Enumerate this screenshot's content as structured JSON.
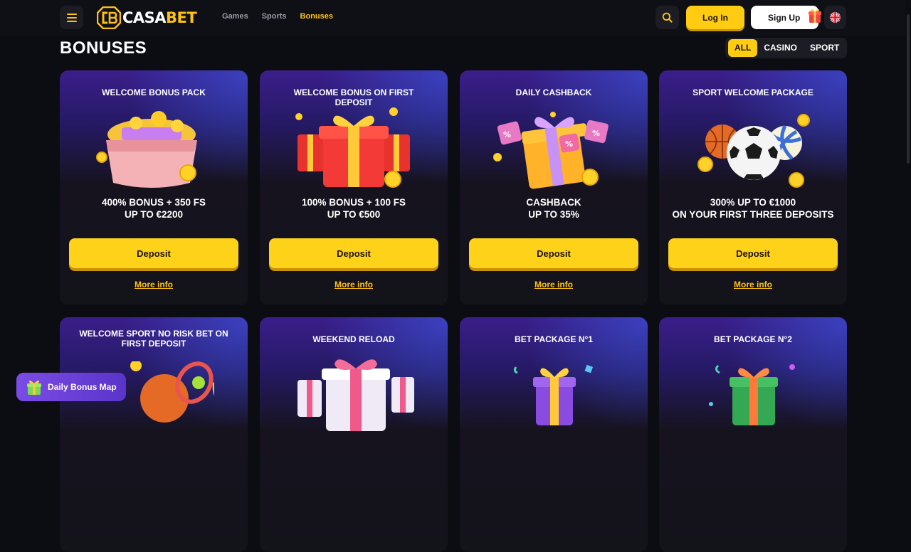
{
  "header": {
    "logo_casa": "CASA",
    "logo_bet": "BET",
    "nav": [
      "Games",
      "Sports",
      "Bonuses"
    ],
    "active_nav": "Bonuses",
    "login_label": "Log In",
    "signup_label": "Sign Up"
  },
  "page": {
    "title": "BONUSES",
    "filters": [
      "ALL",
      "CASINO",
      "SPORT"
    ],
    "active_filter": "ALL"
  },
  "cards": [
    {
      "title": "WELCOME BONUS PACK",
      "offer_line1": "400% BONUS + 350 FS",
      "offer_line2": "UP TO €2200",
      "deposit": "Deposit",
      "more": "More info"
    },
    {
      "title": "WELCOME BONUS ON FIRST DEPOSIT",
      "offer_line1": "100% BONUS + 100 FS",
      "offer_line2": "UP TO €500",
      "deposit": "Deposit",
      "more": "More info"
    },
    {
      "title": "DAILY CASHBACK",
      "offer_line1": "CASHBACK",
      "offer_line2": "UP TO 35%",
      "deposit": "Deposit",
      "more": "More info"
    },
    {
      "title": "SPORT WELCOME PACKAGE",
      "offer_line1": "300% UP TO €1000",
      "offer_line2": "ON YOUR FIRST THREE DEPOSITS",
      "deposit": "Deposit",
      "more": "More info"
    },
    {
      "title": "WELCOME SPORT NO RISK BET ON FIRST DEPOSIT"
    },
    {
      "title": "WEEKEND RELOAD"
    },
    {
      "title": "BET PACKAGE N°1"
    },
    {
      "title": "BET PACKAGE N°2"
    }
  ],
  "daily_bonus_map": "Daily Bonus Map",
  "colors": {
    "accent": "#ffc20e",
    "button": "#ffd21a",
    "background": "#0c0d12",
    "card_top": "#3a1e8a"
  }
}
